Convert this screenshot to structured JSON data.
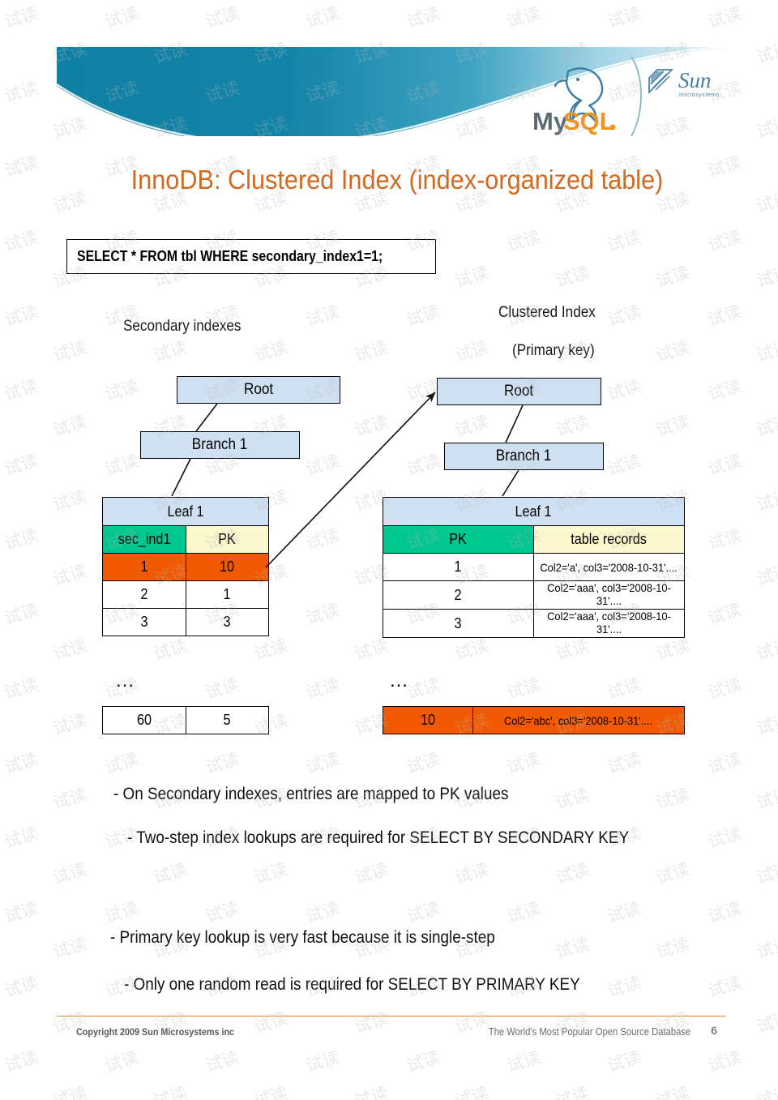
{
  "slide": {
    "title": "InnoDB: Clustered Index (index-organized table)",
    "title_color": "#d2691e",
    "sql": "SELECT * FROM tbl WHERE secondary_index1=1;"
  },
  "brand": {
    "mysql_my": "My",
    "mysql_sql": "SQL",
    "mysql_dot": ".",
    "sun_name": "Sun",
    "sun_sub": "microsystems",
    "banner_color_left": "#0f7fa3",
    "banner_color_right": "#d9eef6"
  },
  "diagram": {
    "left": {
      "caption": "Secondary indexes",
      "root": "Root",
      "branch": "Branch 1",
      "leaf": "Leaf 1",
      "headers": [
        "sec_ind1",
        "PK"
      ],
      "rows": [
        {
          "cells": [
            "1",
            "10"
          ],
          "highlight": true
        },
        {
          "cells": [
            "2",
            "1"
          ],
          "highlight": false
        },
        {
          "cells": [
            "3",
            "3"
          ],
          "highlight": false
        }
      ],
      "ellipsis": "…",
      "tail_row": {
        "cells": [
          "60",
          "5"
        ],
        "highlight": false
      }
    },
    "right": {
      "caption_line1": "Clustered Index",
      "caption_line2": "(Primary key)",
      "root": "Root",
      "branch": "Branch 1",
      "leaf": "Leaf 1",
      "headers": [
        "PK",
        "table records"
      ],
      "rows": [
        {
          "cells": [
            "1",
            "Col2='a', col3='2008-10-31'...."
          ],
          "highlight": false
        },
        {
          "cells": [
            "2",
            "Col2='aaa', col3='2008-10-31'...."
          ],
          "highlight": false
        },
        {
          "cells": [
            "3",
            "Col2='aaa', col3='2008-10-31'...."
          ],
          "highlight": false
        }
      ],
      "ellipsis": "…",
      "tail_row": {
        "cells": [
          "10",
          "Col2='abc', col3='2008-10-31'...."
        ],
        "highlight": true
      }
    },
    "colors": {
      "node_fill": "#cfe0f2",
      "key_header_fill": "#00c68f",
      "value_header_fill": "#fbf8cd",
      "highlight_fill": "#f15a02"
    }
  },
  "bullets": [
    "- On Secondary indexes, entries are mapped to PK values",
    "- Two-step index lookups are required for SELECT BY SECONDARY KEY",
    "- Primary key lookup is very fast because it is single-step",
    "- Only one random read is required for SELECT BY PRIMARY KEY"
  ],
  "footer": {
    "copyright": "Copyright 2009 Sun Microsystems inc",
    "tagline": "The World's Most Popular Open Source Database",
    "page": "6",
    "rule_color": "#e08a3c"
  },
  "watermark": {
    "text": "试读"
  }
}
